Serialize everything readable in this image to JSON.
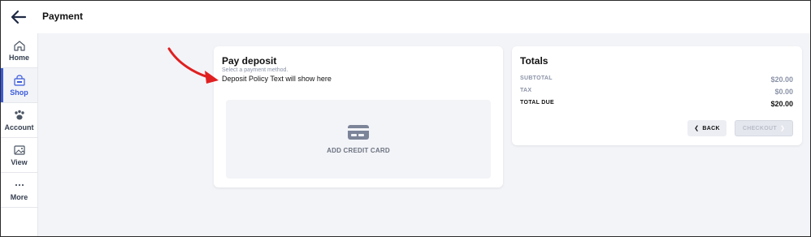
{
  "header": {
    "title": "Payment"
  },
  "sidebar": {
    "items": [
      {
        "label": "Home",
        "icon": "home-icon",
        "active": false
      },
      {
        "label": "Shop",
        "icon": "shop-icon",
        "active": true
      },
      {
        "label": "Account",
        "icon": "paw-icon",
        "active": false
      },
      {
        "label": "View",
        "icon": "image-icon",
        "active": false
      },
      {
        "label": "More",
        "icon": "more-icon",
        "active": false
      }
    ]
  },
  "deposit": {
    "title": "Pay deposit",
    "subtitle": "Select a payment method.",
    "policy_text": "Deposit Policy Text will show here",
    "add_card_label": "ADD CREDIT CARD"
  },
  "totals": {
    "title": "Totals",
    "rows": [
      {
        "label": "SUBTOTAL",
        "value": "$20.00"
      },
      {
        "label": "TAX",
        "value": "$0.00"
      },
      {
        "label": "TOTAL DUE",
        "value": "$20.00"
      }
    ],
    "back_label": "BACK",
    "checkout_label": "CHECKOUT"
  },
  "colors": {
    "accent": "#3b5bdb",
    "annotation_arrow": "#e02020",
    "background": "#f3f4f8"
  }
}
